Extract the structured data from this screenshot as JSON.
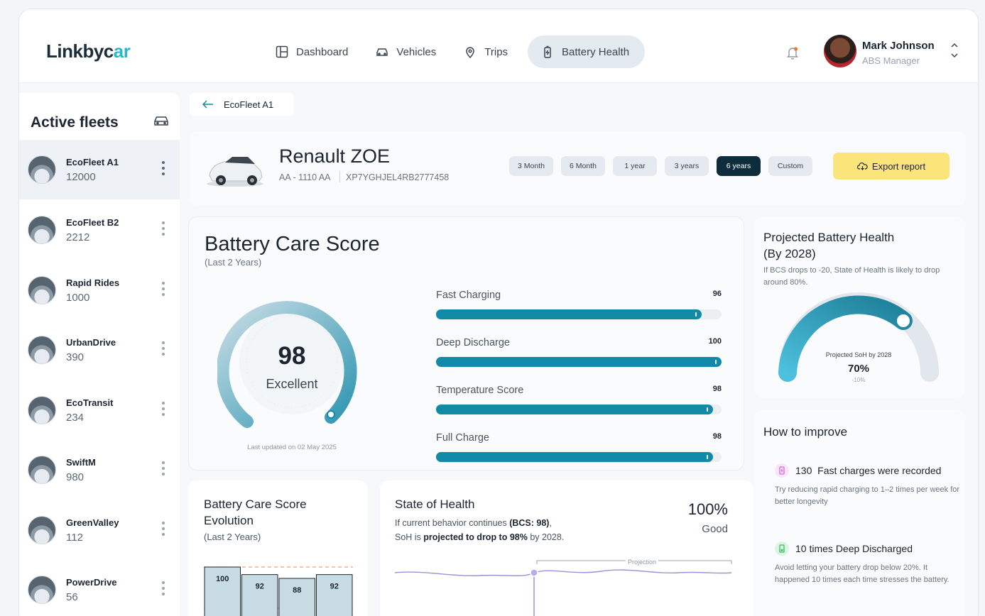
{
  "brand": {
    "logo_main": "Linkbyc",
    "logo_accent": "ar"
  },
  "nav": [
    {
      "label": "Dashboard",
      "icon": "layout-icon"
    },
    {
      "label": "Vehicles",
      "icon": "car-icon"
    },
    {
      "label": "Trips",
      "icon": "map-pin-icon"
    },
    {
      "label": "Battery Health",
      "icon": "battery-icon",
      "active": true
    }
  ],
  "user": {
    "name": "Mark Johnson",
    "role": "ABS Manager"
  },
  "sidebar": {
    "title": "Active fleets",
    "fleets": [
      {
        "name": "EcoFleet A1",
        "count": "12000",
        "active": true
      },
      {
        "name": "EcoFleet B2",
        "count": "2212"
      },
      {
        "name": "Rapid Rides",
        "count": "1000"
      },
      {
        "name": "UrbanDrive",
        "count": "390"
      },
      {
        "name": "EcoTransit",
        "count": "234"
      },
      {
        "name": "SwiftM",
        "count": "980"
      },
      {
        "name": "GreenValley",
        "count": "112"
      },
      {
        "name": "PowerDrive",
        "count": "56"
      }
    ]
  },
  "breadcrumb": {
    "label": "EcoFleet A1"
  },
  "vehicle": {
    "name": "Renault ZOE",
    "plate": "AA - 1110 AA",
    "vin": "XP7YGHJEL4RB2777458",
    "periods": [
      "3 Month",
      "6 Month",
      "1 year",
      "3 years",
      "6 years",
      "Custom"
    ],
    "active_period": "6 years",
    "export_label": "Export report"
  },
  "bcs": {
    "title": "Battery Care Score",
    "subtitle": "(Last 2 Years)",
    "score": "98",
    "score_label": "Excellent",
    "updated": "Last updated on 02 May 2025",
    "metrics": [
      {
        "name": "Fast Charging",
        "value": "96",
        "fill": 0.93
      },
      {
        "name": "Deep Discharge",
        "value": "100",
        "fill": 1.0
      },
      {
        "name": "Temperature Score",
        "value": "98",
        "fill": 0.97
      },
      {
        "name": "Full Charge",
        "value": "98",
        "fill": 0.97
      }
    ]
  },
  "projected": {
    "title_line1": "Projected Battery Health",
    "title_line2": "(By 2028)",
    "description": "If BCS drops to -20, State of Health is likely to drop around 80%.",
    "gauge_label": "Projected SoH by 2028",
    "gauge_value": "70%",
    "gauge_change": "-10%"
  },
  "improve": {
    "title": "How to improve",
    "tips": [
      {
        "count": "130",
        "headline": "Fast charges were recorded",
        "body": "Try reducing rapid charging to 1–2 times per week for better longevity",
        "color": "#d86ad8",
        "icon": "battery-charging-icon"
      },
      {
        "count": "10 times",
        "headline": "Deep Discharged",
        "body": "Avoid letting your battery drop below 20%. It happened 10 times each time stresses the battery.",
        "color": "#3db86a",
        "icon": "battery-low-icon"
      }
    ]
  },
  "evolution": {
    "title_line1": "Battery Care Score",
    "title_line2": "Evolution",
    "subtitle": "(Last 2 Years)",
    "bars": [
      "100",
      "92",
      "88",
      "92"
    ]
  },
  "soh": {
    "title": "State of Health",
    "desc_pre": "If current behavior continues ",
    "desc_bold1": "(BCS: 98)",
    "desc_mid": ",",
    "desc_line2_pre": "SoH is ",
    "desc_bold2": "projected to drop to 98%",
    "desc_post": " by 2028.",
    "value": "100%",
    "status": "Good",
    "projection_label": "Projection"
  },
  "chart_data": {
    "type": "bar",
    "categories": [
      "",
      "",
      "",
      ""
    ],
    "values": [
      100,
      92,
      88,
      92
    ],
    "title": "Battery Care Score Evolution",
    "xlabel": "",
    "ylabel": "",
    "ylim": [
      0,
      110
    ]
  },
  "colors": {
    "accent": "#108aa6",
    "active_period": "#0d2d3d",
    "export": "#fbe47a"
  }
}
